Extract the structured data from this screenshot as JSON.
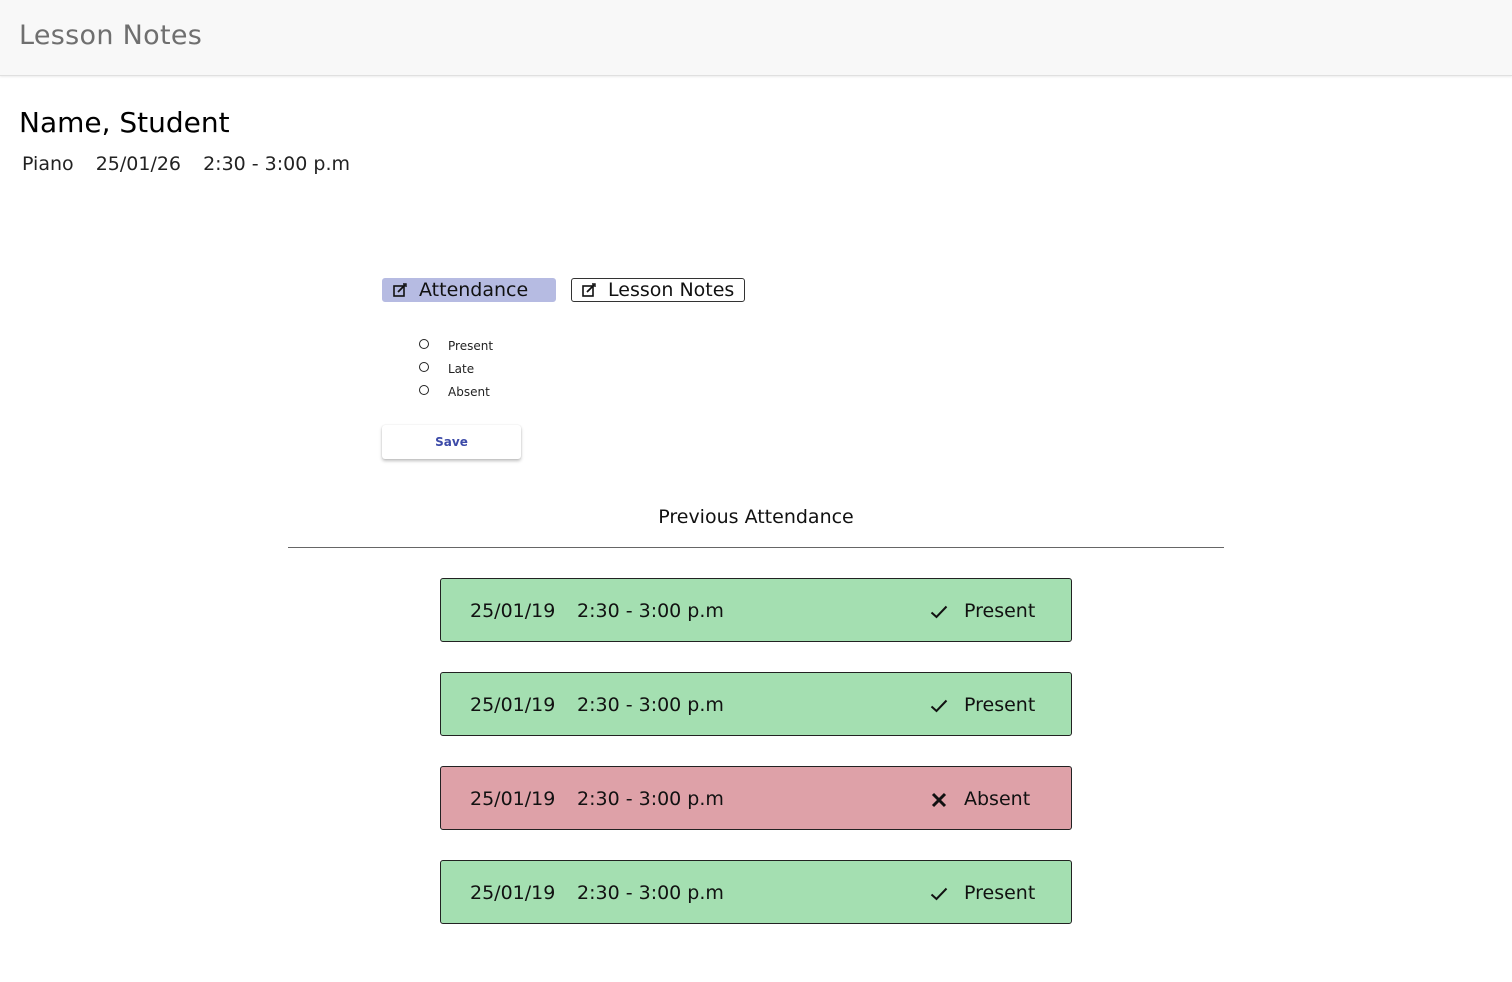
{
  "header": {
    "title": "Lesson Notes"
  },
  "student": {
    "name": "Name, Student",
    "instrument": "Piano",
    "date": "25/01/26",
    "time": "2:30 - 3:00 p.m"
  },
  "tabs": [
    {
      "label": "Attendance",
      "icon": "edit-checkbox-icon",
      "active": true
    },
    {
      "label": "Lesson Notes",
      "icon": "edit-checkbox-icon",
      "active": false
    }
  ],
  "attendance_form": {
    "options": [
      "Present",
      "Late",
      "Absent"
    ],
    "selected": null,
    "save_label": "Save"
  },
  "history": {
    "heading": "Previous Attendance",
    "records": [
      {
        "date": "25/01/19",
        "time": "2:30 - 3:00 p.m",
        "status": "Present",
        "icon": "check-icon"
      },
      {
        "date": "25/01/19",
        "time": "2:30 - 3:00 p.m",
        "status": "Present",
        "icon": "check-icon"
      },
      {
        "date": "25/01/19",
        "time": "2:30 - 3:00 p.m",
        "status": "Absent",
        "icon": "cross-icon"
      },
      {
        "date": "25/01/19",
        "time": "2:30 - 3:00 p.m",
        "status": "Present",
        "icon": "check-icon"
      }
    ]
  },
  "colors": {
    "active_tab": "#b6bbe2",
    "present": "#a4dfb1",
    "absent": "#dea1a8",
    "accent": "#3c4aa8"
  }
}
